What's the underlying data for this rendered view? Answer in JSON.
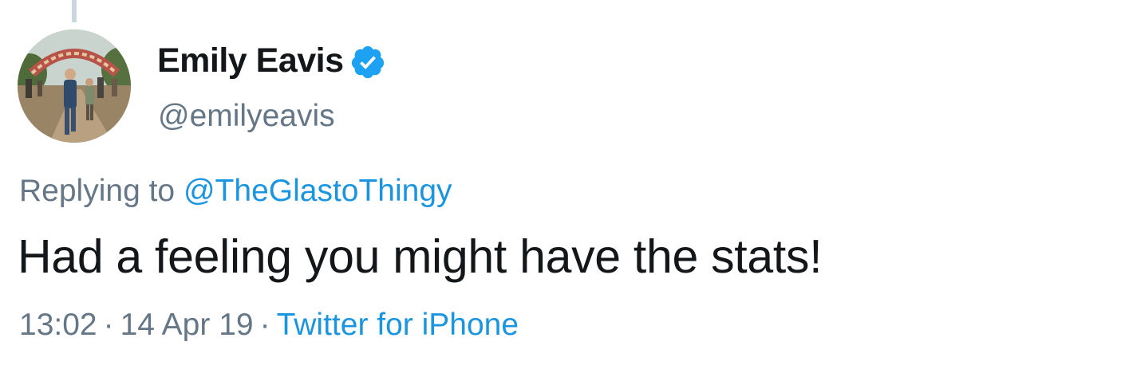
{
  "author": {
    "display_name": "Emily Eavis",
    "handle": "@emilyeavis",
    "verified_icon": "verified-badge-icon",
    "avatar_icon": "profile-photo"
  },
  "reply": {
    "prefix": "Replying to",
    "mention": "@TheGlastoThingy"
  },
  "tweet": {
    "text": "Had a feeling you might have the stats!"
  },
  "meta": {
    "time": "13:02",
    "separator": "·",
    "date": "14 Apr 19",
    "source": "Twitter for iPhone"
  },
  "colors": {
    "text_primary": "#14171a",
    "text_secondary": "#657786",
    "link": "#1b95e0",
    "verified": "#1da1f2",
    "thread_line": "#ccd6dd"
  }
}
